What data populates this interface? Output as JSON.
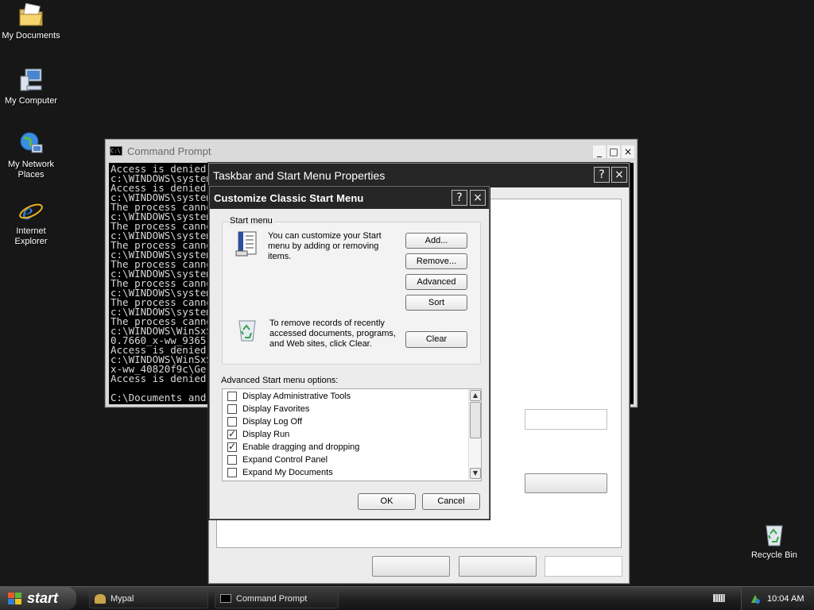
{
  "desktop": {
    "icons": [
      {
        "label": "My Documents"
      },
      {
        "label": "My Computer"
      },
      {
        "label": "My Network Places"
      },
      {
        "label": "Internet Explorer"
      },
      {
        "label": "Recycle Bin"
      }
    ]
  },
  "cmd_window": {
    "title": "Command Prompt",
    "lines": [
      "Access is denied.",
      "c:\\WINDOWS\\system32",
      "Access is denied.",
      "c:\\WINDOWS\\system32",
      "The process cannot",
      "c:\\WINDOWS\\system32",
      "The process cannot",
      "c:\\WINDOWS\\system32",
      "The process cannot",
      "c:\\WINDOWS\\system32",
      "The process cannot",
      "c:\\WINDOWS\\system32",
      "The process cannot",
      "c:\\WINDOWS\\system32",
      "The process cannot",
      "c:\\WINDOWS\\system32",
      "The process cannot",
      "c:\\WINDOWS\\WinSxS",
      "0.7660_x-ww_9365",
      "Access is denied.",
      "c:\\WINDOWS\\WinSxS",
      "x-ww_40820f9c\\Ge",
      "Access is denied.",
      "",
      "C:\\Documents and"
    ],
    "buttons": {
      "minimize": "_",
      "maximize": "□",
      "close": "×"
    }
  },
  "taskbar_props": {
    "title": "Taskbar and Start Menu Properties",
    "buttons": {
      "help": "?",
      "close": "×"
    }
  },
  "customize_dialog": {
    "title": "Customize Classic Start Menu",
    "buttons": {
      "help": "?",
      "close": "×"
    },
    "start_menu_group": {
      "legend": "Start menu",
      "description": "You can customize your Start menu by adding or removing items.",
      "add": "Add...",
      "remove": "Remove...",
      "advanced": "Advanced",
      "sort": "Sort",
      "clear_text": "To remove records of recently accessed documents, programs, and Web sites, click Clear.",
      "clear": "Clear"
    },
    "advanced_label": "Advanced Start menu options:",
    "options": [
      {
        "label": "Display Administrative Tools",
        "checked": false
      },
      {
        "label": "Display Favorites",
        "checked": false
      },
      {
        "label": "Display Log Off",
        "checked": false
      },
      {
        "label": "Display Run",
        "checked": true
      },
      {
        "label": "Enable dragging and dropping",
        "checked": true
      },
      {
        "label": "Expand Control Panel",
        "checked": false
      },
      {
        "label": "Expand My Documents",
        "checked": false
      }
    ],
    "ok": "OK",
    "cancel": "Cancel"
  },
  "taskbar": {
    "start_label": "start",
    "tasks": [
      {
        "label": "Mypal"
      },
      {
        "label": "Command Prompt"
      }
    ],
    "clock": "10:04 AM"
  }
}
